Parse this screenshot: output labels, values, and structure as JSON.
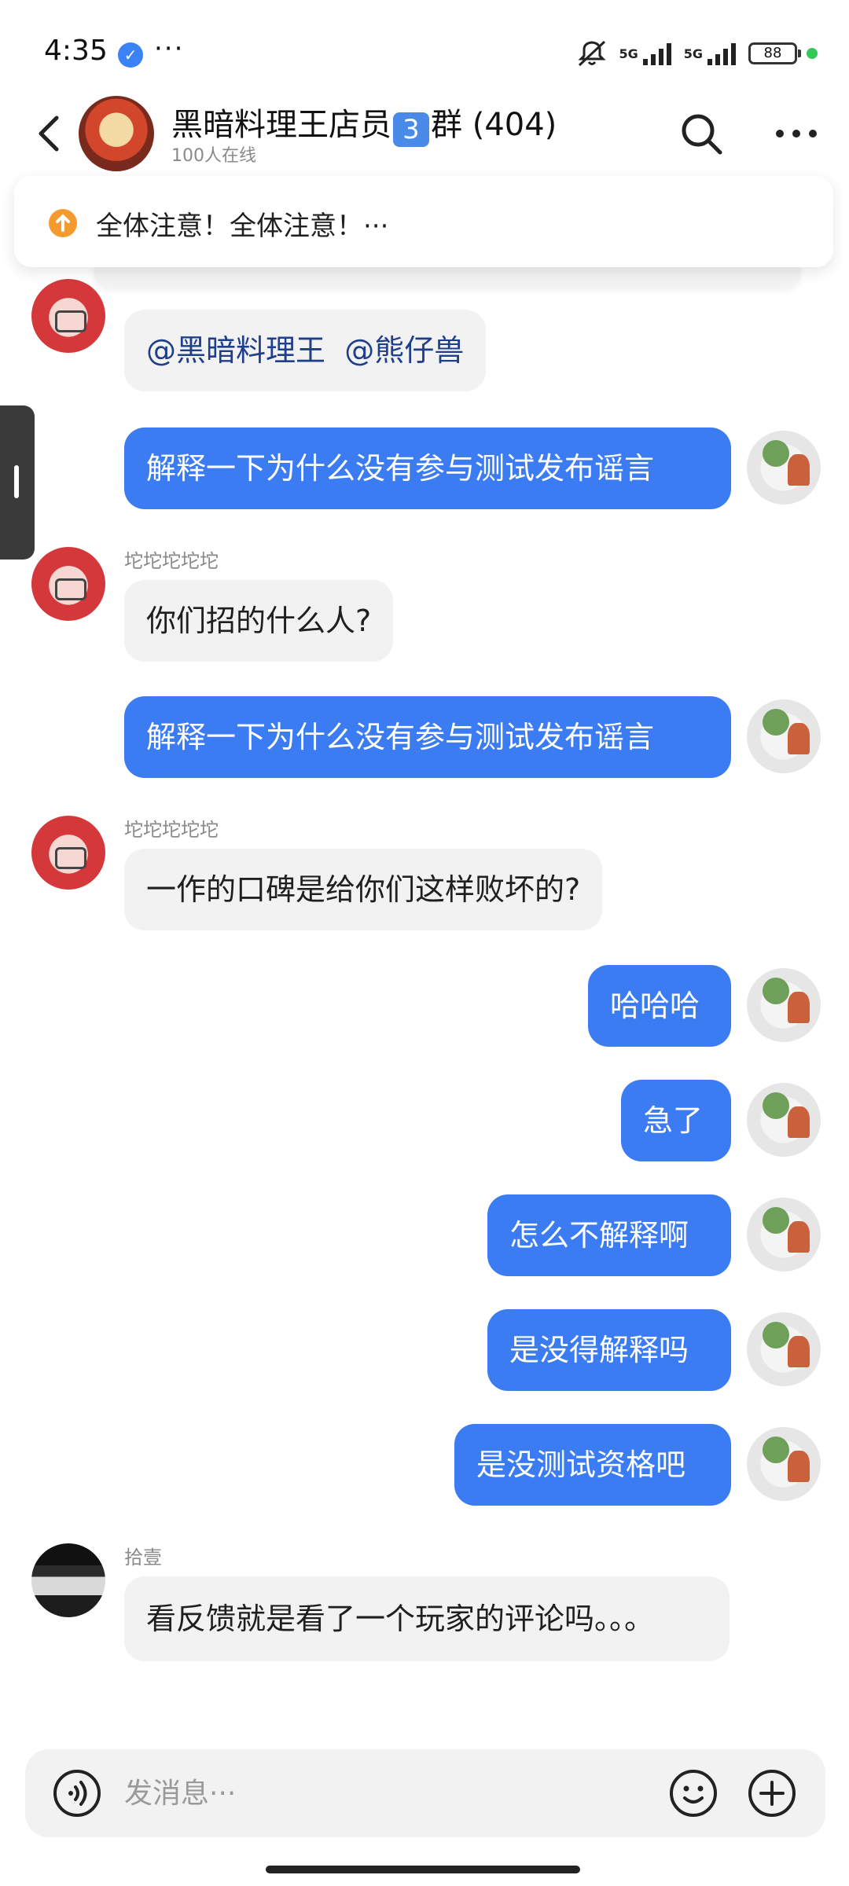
{
  "status_bar": {
    "time": "4:35",
    "more": "···",
    "network_1": "5G",
    "network_2": "5G",
    "battery": "88"
  },
  "header": {
    "title_prefix": "黑暗料理王店员",
    "title_emoji": "3",
    "title_suffix": "群 (404)",
    "online": "100人在线"
  },
  "notice": {
    "text": "全体注意！全体注意！···"
  },
  "messages": [
    {
      "side": "in",
      "sender": "",
      "mention_1": "@黑暗料理王",
      "mention_2": "@熊仔兽"
    },
    {
      "side": "out",
      "text": "解释一下为什么没有参与测试发布谣言"
    },
    {
      "side": "in",
      "sender": "坨坨坨坨坨",
      "text": "你们招的什么人?"
    },
    {
      "side": "out",
      "text": "解释一下为什么没有参与测试发布谣言"
    },
    {
      "side": "in",
      "sender": "坨坨坨坨坨",
      "text": "一作的口碑是给你们这样败坏的?"
    },
    {
      "side": "out",
      "text": "哈哈哈"
    },
    {
      "side": "out",
      "text": "急了"
    },
    {
      "side": "out",
      "text": "怎么不解释啊"
    },
    {
      "side": "out",
      "text": "是没得解释吗"
    },
    {
      "side": "out",
      "text": "是没测试资格吧"
    },
    {
      "side": "in",
      "sender": "拾壹",
      "text": "看反馈就是看了一个玩家的评论吗。。。"
    }
  ],
  "input": {
    "placeholder": "发消息···"
  },
  "colors": {
    "outgoing_bubble": "#3c7cf3",
    "incoming_bubble": "#f2f2f2",
    "notice_icon": "#f59a2f",
    "battery_dot": "#34c759"
  }
}
